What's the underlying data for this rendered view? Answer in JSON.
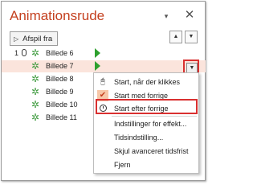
{
  "pane": {
    "title": "Animationsrude",
    "dropdown_icon": "▾",
    "close_icon": "✕",
    "play_label": "Afspil fra",
    "up_icon": "▲",
    "down_icon": "▼"
  },
  "rows": [
    {
      "number": "1",
      "label": "Billede 6"
    },
    {
      "number": "",
      "label": "Billede 7"
    },
    {
      "number": "",
      "label": "Billede 8"
    },
    {
      "number": "",
      "label": "Billede 9"
    },
    {
      "number": "",
      "label": "Billede 10"
    },
    {
      "number": "",
      "label": "Billede 11"
    }
  ],
  "row_dropdown_icon": "▼",
  "menu": {
    "items": [
      {
        "label": "Start, når der klikkes",
        "icon": "mouse-icon"
      },
      {
        "label": "Start med forrige",
        "icon": "checkmark-icon",
        "checked": true
      },
      {
        "label": "Start efter forrige",
        "icon": "clock-icon",
        "highlighted": true
      },
      {
        "label": "Indstillinger for effekt..."
      },
      {
        "label": "Tidsindstilling..."
      },
      {
        "label": "Skjul avanceret tidsfrist"
      },
      {
        "label": "Fjern"
      }
    ]
  },
  "colors": {
    "title": "#c4401f",
    "highlight_border": "#d93030",
    "selected_row": "#fbe4dc",
    "trigger": "#2ea02e",
    "star": "#3d9a3d"
  }
}
